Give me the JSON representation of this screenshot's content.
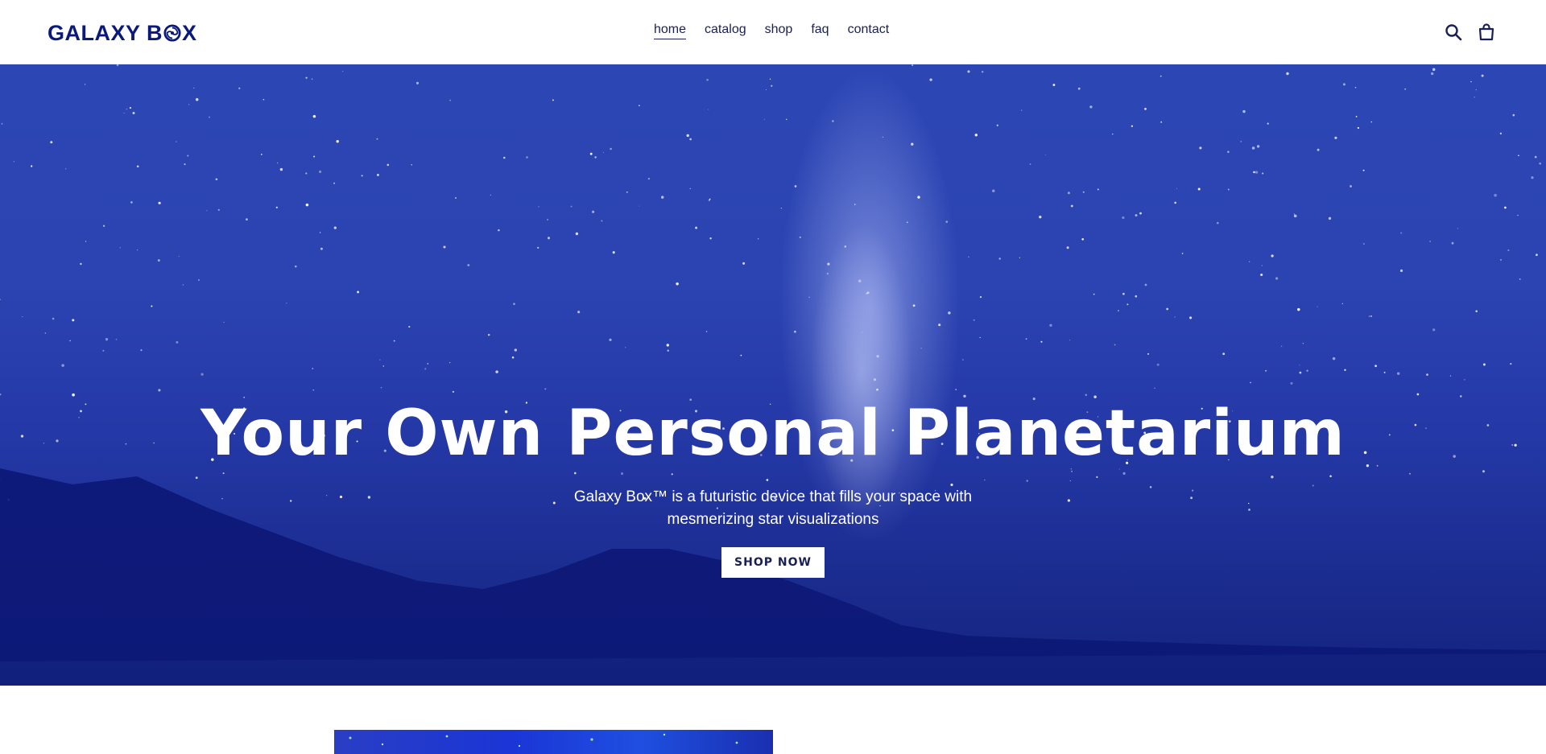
{
  "brand": {
    "logo_text_left": "GALAXY B",
    "logo_text_right": "X",
    "logo_icon": "galaxy-swirl-icon",
    "color": "#0b1a7a"
  },
  "nav": {
    "items": [
      {
        "label": "home",
        "active": true
      },
      {
        "label": "catalog",
        "active": false
      },
      {
        "label": "shop",
        "active": false
      },
      {
        "label": "faq",
        "active": false
      },
      {
        "label": "contact",
        "active": false
      }
    ]
  },
  "header_icons": [
    "search-icon",
    "cart-icon"
  ],
  "hero": {
    "title": "Your Own Personal Planetarium",
    "subtitle": "Galaxy Box™ is a futuristic device that fills your space with mesmerizing star visualizations",
    "cta_label": "SHOP NOW"
  },
  "colors": {
    "accent": "#1a1f55",
    "hero_sky": "#2c46b4",
    "hero_ground": "#0d1876"
  }
}
